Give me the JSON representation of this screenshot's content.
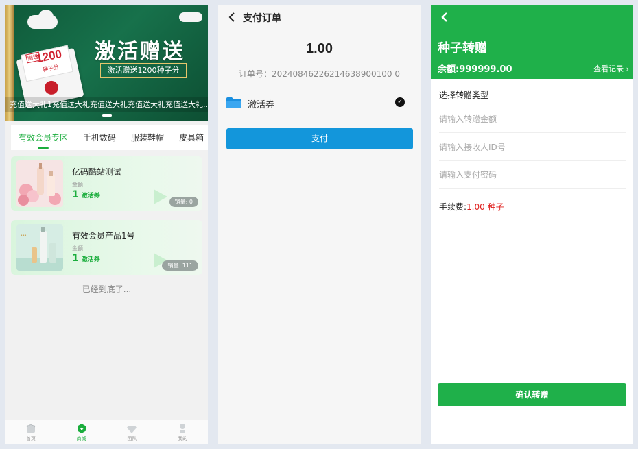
{
  "shop": {
    "banner": {
      "title": "激活赠送",
      "subtitle": "激活赠送1200种子分",
      "envelope_number": "1200",
      "envelope_sub": "种子分",
      "envelope_tag": "赠送",
      "marquee": "充值送大礼1充值送大礼充值送大礼充值送大礼充值送大礼..."
    },
    "tabs": [
      "有效会员专区",
      "手机数码",
      "服装鞋帽",
      "皮具箱"
    ],
    "products": [
      {
        "name": "亿码酷站测试",
        "amount_label": "金额",
        "amount": "1",
        "unit": "激活券",
        "sales": "销量: 0"
      },
      {
        "name": "有效会员产品1号",
        "amount_label": "金额",
        "amount": "1",
        "unit": "激活券",
        "sales": "销量: 111"
      }
    ],
    "end_text": "已经到底了...",
    "tabbar": [
      {
        "label": "首页",
        "icon": "home-icon"
      },
      {
        "label": "商城",
        "icon": "shop-icon"
      },
      {
        "label": "团队",
        "icon": "team-icon"
      },
      {
        "label": "我的",
        "icon": "profile-icon"
      }
    ]
  },
  "payment": {
    "title": "支付订单",
    "amount": "1.00",
    "order_no": "订单号：20240846226214638900100 0",
    "method": "激活券",
    "pay_button": "支付"
  },
  "transfer": {
    "title": "种子转赠",
    "balance": "余额:999999.00",
    "records": "查看记录",
    "section": "选择转赠类型",
    "amount_placeholder": "请输入转赠金额",
    "receiver_placeholder": "请输入接收人ID号",
    "password_placeholder": "请输入支付密码",
    "fee_label": "手续费:",
    "fee_value": "1.00 种子",
    "confirm_button": "确认转赠"
  },
  "colors": {
    "green": "#1fb04a",
    "blue": "#1396db",
    "red": "#e0201e"
  }
}
